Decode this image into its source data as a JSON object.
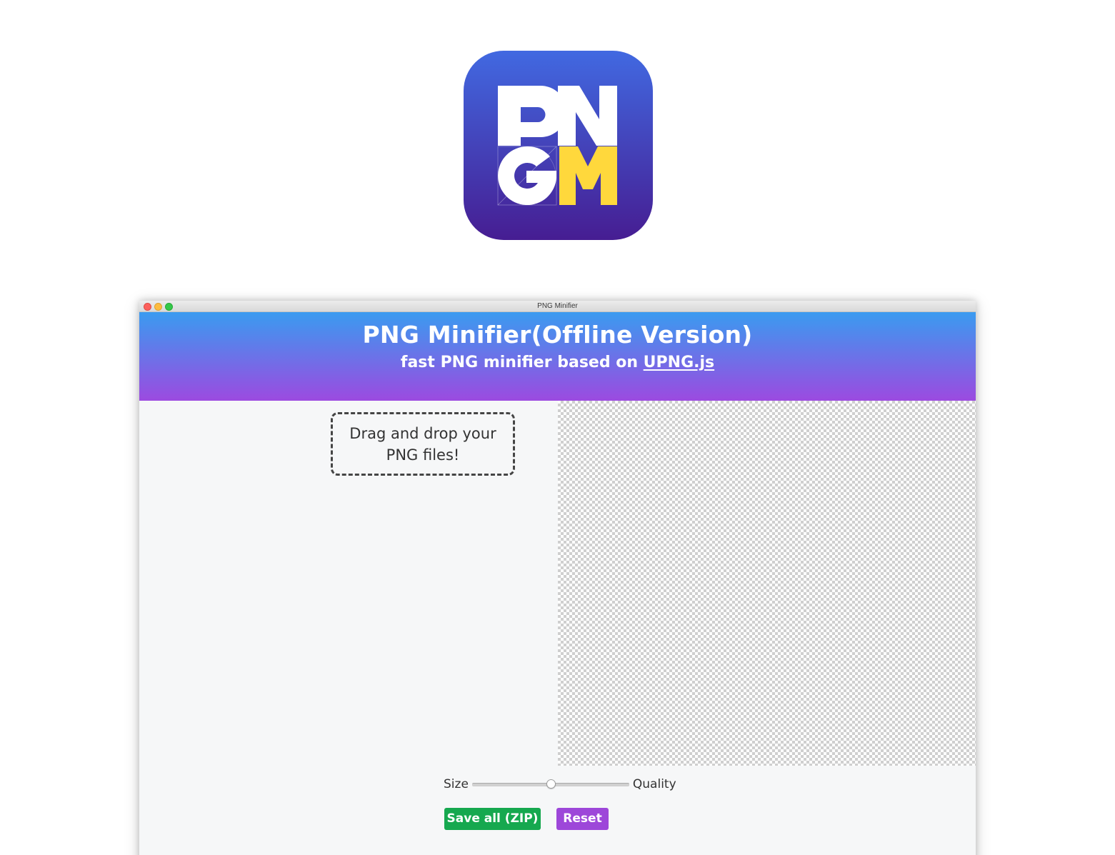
{
  "app_icon": {
    "name": "pngm-app-icon",
    "letters_top": "PN",
    "letters_bottom_left": "G",
    "letters_bottom_right": "M",
    "colors": {
      "gradient_top": "#4169e1",
      "gradient_bottom": "#461d92",
      "letter_white": "#ffffff",
      "letter_yellow": "#ffd83c"
    }
  },
  "window": {
    "title": "PNG Minifier",
    "traffic_lights": [
      "close",
      "minimize",
      "maximize"
    ]
  },
  "header": {
    "title": "PNG Minifier(Offline Version)",
    "subtitle_prefix": "fast PNG minifier based on ",
    "subtitle_link": "UPNG.js",
    "colors": {
      "gradient_top": "#3a9bf0",
      "gradient_bottom": "#9c4ae0"
    }
  },
  "drop_zone": {
    "text": "Drag and drop your PNG files!"
  },
  "preview": {
    "background": "transparency-checkerboard"
  },
  "quality_slider": {
    "left_label": "Size",
    "right_label": "Quality",
    "value_fraction": 0.5
  },
  "buttons": {
    "save_all": {
      "label": "Save all (ZIP)",
      "color": "#16a84f"
    },
    "reset": {
      "label": "Reset",
      "color": "#9d47d9"
    }
  }
}
